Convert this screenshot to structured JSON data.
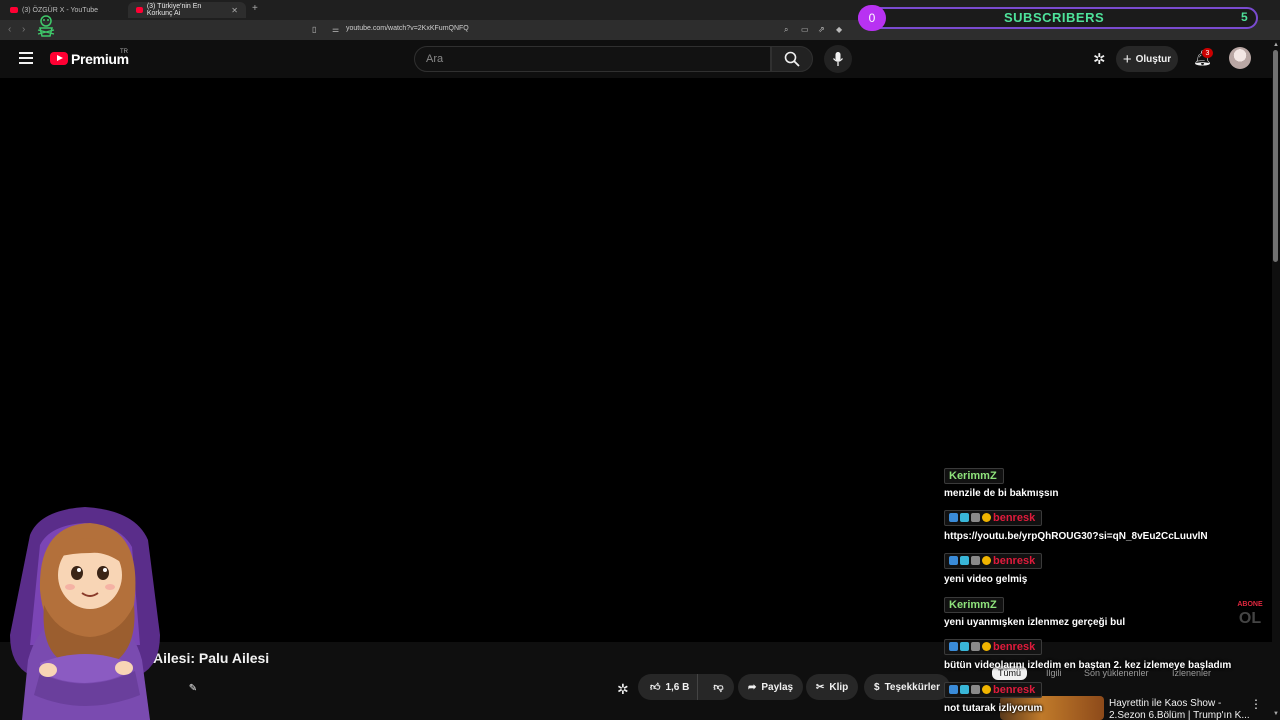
{
  "browser": {
    "tabs": [
      {
        "title": "(3) ÖZGÜR X - YouTube"
      },
      {
        "title": "(3) Türkiye'nin En Korkunç Ai"
      }
    ],
    "new_tab": "+",
    "url": "youtube.com/watch?v=2KxKFumQNFQ"
  },
  "subscriber_overlay": {
    "current": "0",
    "label": "SUBSCRIBERS",
    "goal": "5"
  },
  "header": {
    "logo_text": "Premium",
    "logo_country": "TR",
    "search_placeholder": "Ara",
    "create_label": "Oluştur",
    "notification_count": "3"
  },
  "video": {
    "title": "Ailesi: Palu Ailesi",
    "like_count": "1,6 B",
    "share_label": "Paylaş",
    "clip_label": "Klip",
    "thanks_label": "Teşekkürler"
  },
  "chips": [
    "Tümü",
    "İlgili",
    "Son yüklenenler",
    "İzlenenler"
  ],
  "recommended": [
    {
      "title": "Hayrettin ile Kaos Show - 2.Sezon 6.Bölüm | Trump'ın K..."
    }
  ],
  "chat": [
    {
      "user": "KerimmZ",
      "style": "green",
      "badges": false,
      "text": "menzile de bi bakmışsın"
    },
    {
      "user": "benresk",
      "style": "red",
      "badges": true,
      "text": "https://youtu.be/yrpQhROUG30?si=qN_8vEu2CcLuuvlN"
    },
    {
      "user": "benresk",
      "style": "red",
      "badges": true,
      "text": "yeni video gelmiş"
    },
    {
      "user": "KerimmZ",
      "style": "green",
      "badges": false,
      "text": "yeni uyanmışken izlenmez gerçeği bul"
    },
    {
      "user": "benresk",
      "style": "red",
      "badges": true,
      "text": "bütün videolarını izledim en baştan 2. kez izlemeye başladım"
    },
    {
      "user": "benresk",
      "style": "red",
      "badges": true,
      "text": "not tutarak izliyorum"
    }
  ],
  "abone": {
    "line1": "ABONE",
    "line2": "OL"
  },
  "colors": {
    "youtube_red": "#ff0033",
    "chat_green": "#8fe37c",
    "chat_red": "#e01b3c",
    "subscriber_accent": "#4ee29a",
    "overlay_purple": "#b832f2"
  }
}
